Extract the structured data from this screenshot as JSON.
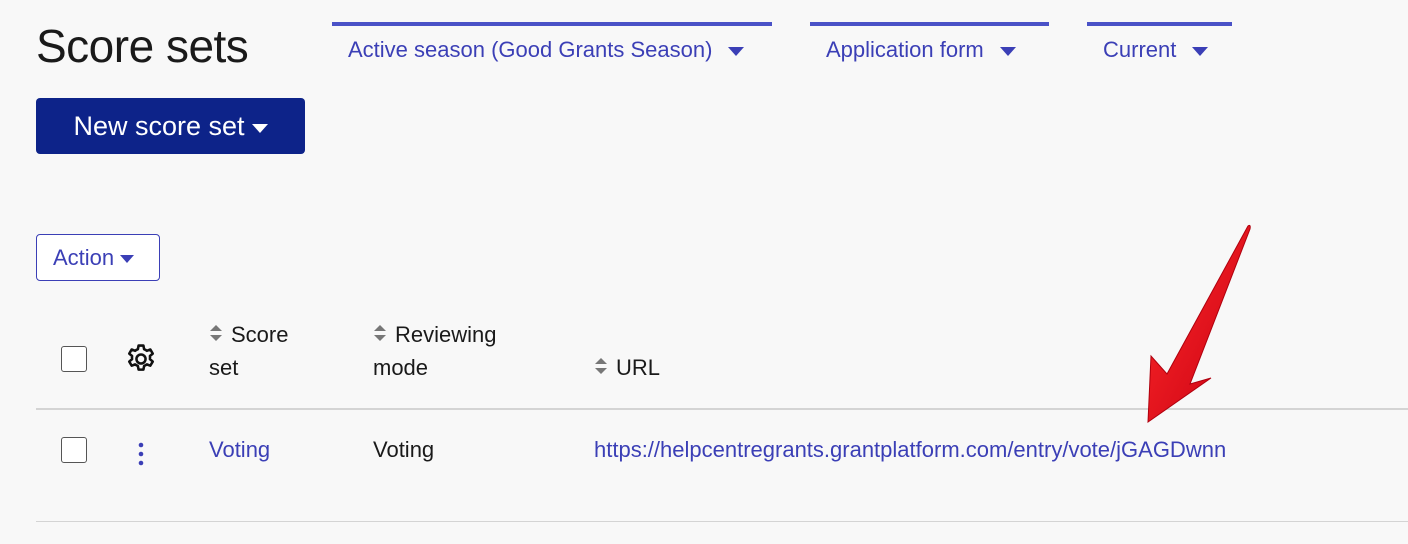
{
  "page": {
    "title": "Score sets"
  },
  "filters": {
    "season": "Active season (Good Grants Season)",
    "form": "Application form",
    "status": "Current"
  },
  "toolbar": {
    "new_label": "New score set",
    "action_label": "Action"
  },
  "table": {
    "headers": {
      "score_set": [
        "Score",
        "set"
      ],
      "reviewing_mode": [
        "Reviewing",
        "mode"
      ],
      "url": "URL"
    },
    "rows": [
      {
        "score_set": "Voting",
        "reviewing_mode": "Voting",
        "url": "https://helpcentregrants.grantplatform.com/entry/vote/jGAGDwnn"
      }
    ]
  },
  "colors": {
    "accent": "#3b3fb6",
    "primary_button": "#0d2389",
    "annotation_arrow": "#e4001b"
  },
  "icons": {
    "header_settings": "gear-icon",
    "row_menu": "kebab-menu-icon",
    "sort": "sort-icon",
    "dropdown": "caret-down-icon",
    "annotation": "red-arrow-icon"
  }
}
